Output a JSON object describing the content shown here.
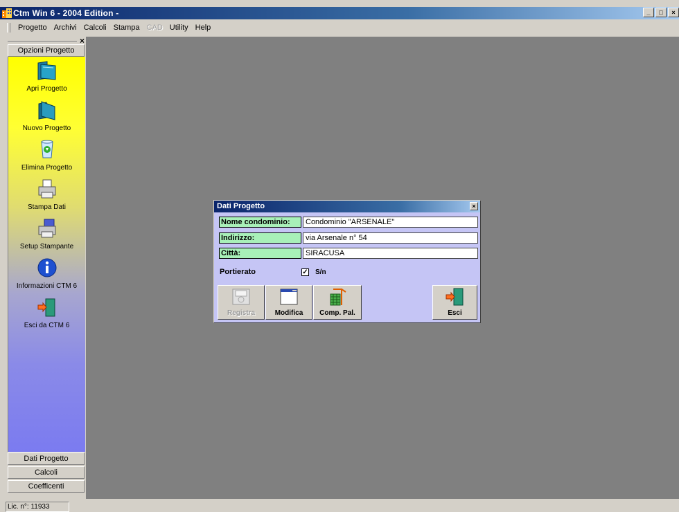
{
  "window": {
    "title": "Ctm Win 6 - 2004 Edition -",
    "controls": {
      "minimize": "_",
      "maximize": "□",
      "close": "×"
    }
  },
  "menubar": {
    "items": [
      {
        "label": "Progetto",
        "enabled": true
      },
      {
        "label": "Archivi",
        "enabled": true
      },
      {
        "label": "Calcoli",
        "enabled": true
      },
      {
        "label": "Stampa",
        "enabled": true
      },
      {
        "label": "CAD",
        "enabled": false
      },
      {
        "label": "Utility",
        "enabled": true
      },
      {
        "label": "Help",
        "enabled": true
      }
    ]
  },
  "sidebar": {
    "close_glyph": "×",
    "header": "Opzioni Progetto",
    "items": [
      {
        "label": "Apri Progetto",
        "icon": "open-folder-icon"
      },
      {
        "label": "Nuovo Progetto",
        "icon": "new-folder-icon"
      },
      {
        "label": "Elimina Progetto",
        "icon": "recycle-bin-icon"
      },
      {
        "label": "Stampa Dati",
        "icon": "printer-icon"
      },
      {
        "label": "Setup Stampante",
        "icon": "printer-setup-icon"
      },
      {
        "label": "Informazioni CTM 6",
        "icon": "info-icon"
      },
      {
        "label": "Esci da CTM 6",
        "icon": "exit-door-icon"
      }
    ],
    "bottom_panels": [
      "Dati Progetto",
      "Calcoli",
      "Coefficenti"
    ]
  },
  "dialog": {
    "title": "Dati Progetto",
    "close_glyph": "×",
    "fields": [
      {
        "label": "Nome condominio:",
        "value": "Condominio \"ARSENALE\""
      },
      {
        "label": "Indirizzo:",
        "value": "via Arsenale n° 54"
      },
      {
        "label": "Città:",
        "value": "SIRACUSA"
      }
    ],
    "portierato": {
      "label": "Portierato",
      "checked": true,
      "check_glyph": "✓",
      "option_label": "S/n"
    },
    "buttons": {
      "registra": "Registra",
      "modifica": "Modifica",
      "comp_pal": "Comp. Pal.",
      "esci": "Esci"
    }
  },
  "statusbar": {
    "license": "Lic. n°: 11933"
  },
  "colors": {
    "titlebar_start": "#0a246a",
    "workspace": "#808080",
    "dialog_bg": "#c5c5f5",
    "field_label_bg": "#a8f0b8",
    "sidebar_top": "#ffff00",
    "sidebar_bottom": "#7b7bf0"
  }
}
